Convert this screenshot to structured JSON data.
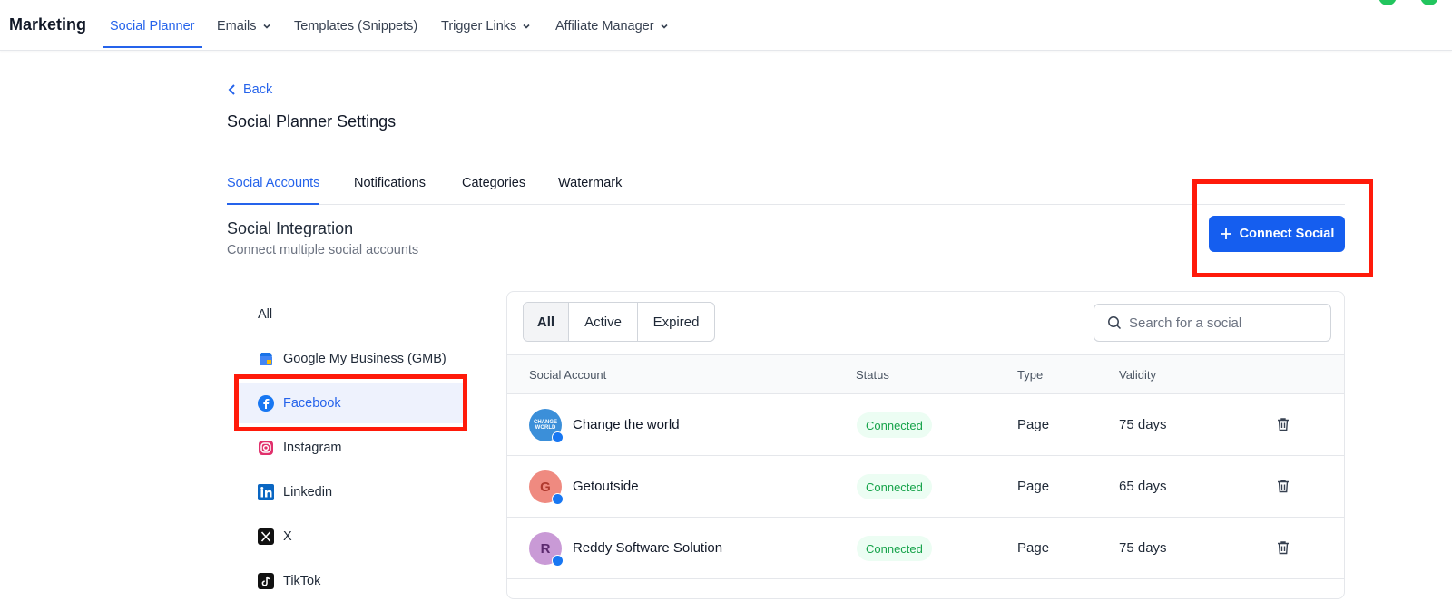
{
  "header": {
    "brand": "Marketing",
    "nav": [
      {
        "label": "Social Planner",
        "active": true
      },
      {
        "label": "Emails",
        "dropdown": true
      },
      {
        "label": "Templates (Snippets)"
      },
      {
        "label": "Trigger Links",
        "dropdown": true
      },
      {
        "label": "Affiliate Manager",
        "dropdown": true
      }
    ]
  },
  "page": {
    "back_label": "Back",
    "title": "Social Planner Settings"
  },
  "tabs": [
    {
      "label": "Social Accounts",
      "active": true
    },
    {
      "label": "Notifications"
    },
    {
      "label": "Categories"
    },
    {
      "label": "Watermark"
    }
  ],
  "section": {
    "title": "Social Integration",
    "subtitle": "Connect multiple social accounts",
    "connect_button": "Connect Social"
  },
  "sidebar": {
    "items": [
      {
        "label": "All",
        "icon": "none"
      },
      {
        "label": "Google My Business (GMB)",
        "icon": "gmb-icon"
      },
      {
        "label": "Facebook",
        "icon": "facebook-icon",
        "active": true
      },
      {
        "label": "Instagram",
        "icon": "instagram-icon"
      },
      {
        "label": "Linkedin",
        "icon": "linkedin-icon"
      },
      {
        "label": "X",
        "icon": "x-icon"
      },
      {
        "label": "TikTok",
        "icon": "tiktok-icon"
      }
    ]
  },
  "filters": {
    "options": [
      "All",
      "Active",
      "Expired"
    ],
    "selected": "All",
    "search_placeholder": "Search for a social"
  },
  "table": {
    "columns": [
      "Social Account",
      "Status",
      "Type",
      "Validity"
    ],
    "rows": [
      {
        "name": "Change the world",
        "avatar_text": "CHANGE WORLD",
        "avatar_color": "#3b8fd9",
        "status": "Connected",
        "type": "Page",
        "validity": "75 days"
      },
      {
        "name": "Getoutside",
        "avatar_text": "G",
        "avatar_color": "#ef8a80",
        "status": "Connected",
        "type": "Page",
        "validity": "65 days"
      },
      {
        "name": "Reddy Software Solution",
        "avatar_text": "R",
        "avatar_color": "#c99ad6",
        "status": "Connected",
        "type": "Page",
        "validity": "75 days"
      }
    ]
  },
  "colors": {
    "accent": "#2563eb",
    "button": "#155eef",
    "highlight": "#ff1a0a",
    "status_green": "#16a34a"
  }
}
